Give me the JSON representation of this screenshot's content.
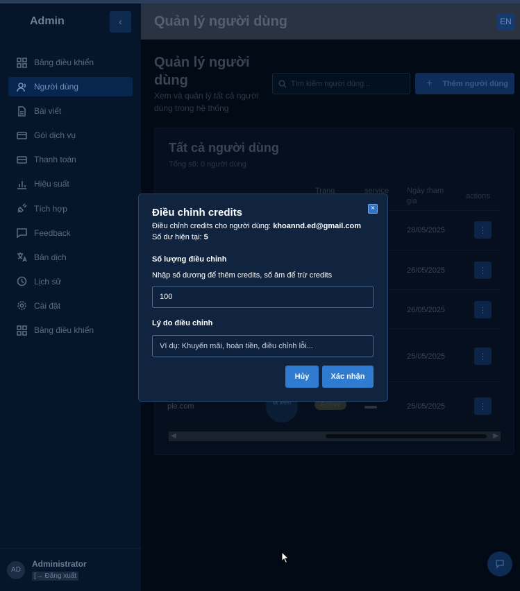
{
  "sidebar": {
    "title": "Admin",
    "toggle_icon": "‹",
    "items": [
      {
        "label": "Bảng điều khiển",
        "icon": "dashboard-icon"
      },
      {
        "label": "Người dùng",
        "icon": "users-icon",
        "active": true
      },
      {
        "label": "Bài viết",
        "icon": "document-icon"
      },
      {
        "label": "Gói dịch vụ",
        "icon": "card-icon"
      },
      {
        "label": "Thanh toán",
        "icon": "payment-icon"
      },
      {
        "label": "Hiệu suất",
        "icon": "chart-icon"
      },
      {
        "label": "Tích hợp",
        "icon": "plug-icon"
      },
      {
        "label": "Feedback",
        "icon": "message-icon"
      },
      {
        "label": "Bản dịch",
        "icon": "translate-icon"
      },
      {
        "label": "Lịch sử",
        "icon": "clock-icon"
      },
      {
        "label": "Cài đặt",
        "icon": "gear-icon"
      },
      {
        "label": "Bảng điều khiển",
        "icon": "dashboard-icon"
      }
    ],
    "footer": {
      "avatar": "AD",
      "name": "Administrator",
      "logout": "[→ Đăng xuất"
    }
  },
  "header": {
    "title": "Quản lý người dùng",
    "lang": "EN"
  },
  "main": {
    "title": "Quản lý người dùng",
    "subtitle": "Xem và quản lý tất cả người dùng trong hệ thống",
    "search_placeholder": "Tìm kiếm người dùng...",
    "add_button": "Thêm người dùng",
    "card": {
      "title": "Tất cả người dùng",
      "subtitle": "Tổng số: 0 người dùng",
      "headers": {
        "status": "Trạng",
        "service": "service",
        "joined": "Ngày tham gia",
        "actions": "actions"
      },
      "dates": [
        "28/05/2025",
        "26/05/2025",
        "26/05/2025",
        "25/05/2025",
        "25/05/2025"
      ],
      "last_row": {
        "email": "ple.com",
        "role": "bị viên",
        "status": "Active"
      }
    }
  },
  "modal": {
    "title": "Điều chỉnh credits",
    "desc_prefix": "Điều chỉnh credits cho người dùng:",
    "email": "khoannd.ed@gmail.com",
    "balance_prefix": "Số dư hiện tại:",
    "balance": "5",
    "amount_label": "Số lượng điều chỉnh",
    "amount_help": "Nhập số dương để thêm credits, số âm để trừ credits",
    "amount_value": "100",
    "reason_label": "Lý do điều chỉnh",
    "reason_placeholder": "Ví dụ: Khuyến mãi, hoàn tiền, điều chỉnh lỗi...",
    "cancel": "Hủy",
    "confirm": "Xác nhận",
    "close_icon": "×"
  },
  "colors": {
    "accent": "#2f7bd0",
    "modal_bg": "#102440",
    "page_bg": "#020a16"
  }
}
